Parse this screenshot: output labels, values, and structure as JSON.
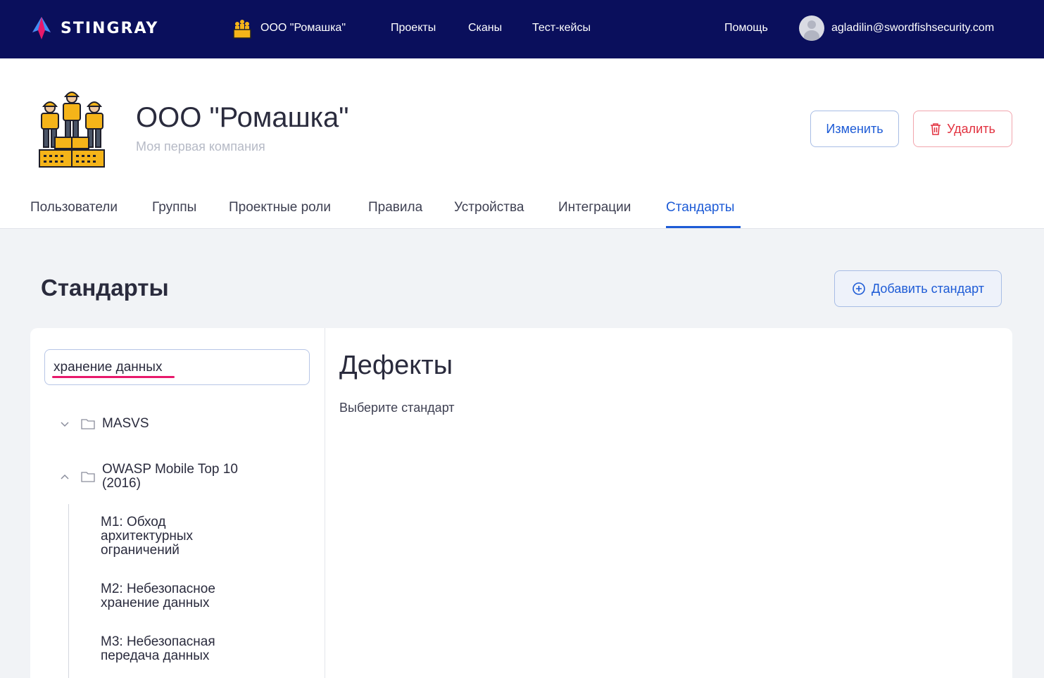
{
  "topbar": {
    "brand": "STINGRAY",
    "org_name": "ООО \"Ромашка\"",
    "nav": [
      "Проекты",
      "Сканы",
      "Тест-кейсы"
    ],
    "help": "Помощь",
    "user_email": "agladilin@swordfishsecurity.com",
    "background": "#0a0f5c"
  },
  "company": {
    "title": "ООО \"Ромашка\"",
    "subtitle": "Моя первая компания",
    "edit_label": "Изменить",
    "delete_label": "Удалить"
  },
  "tabs": [
    {
      "label": "Пользователи",
      "active": false
    },
    {
      "label": "Группы",
      "active": false
    },
    {
      "label": "Проектные роли",
      "active": false
    },
    {
      "label": "Правила",
      "active": false
    },
    {
      "label": "Устройства",
      "active": false
    },
    {
      "label": "Интеграции",
      "active": false
    },
    {
      "label": "Стандарты",
      "active": true
    }
  ],
  "section": {
    "title": "Стандарты",
    "add_label": "Добавить стандарт"
  },
  "search": {
    "value": "хранение данных"
  },
  "tree": {
    "nodes": [
      {
        "label": "MASVS",
        "expanded": false
      },
      {
        "label": "OWASP Mobile Top 10 (2016)",
        "expanded": true
      }
    ],
    "leaves": [
      "M1: Обход архитектурных ограничений",
      "M2: Небезопасное хранение данных",
      "M3: Небезопасная передача данных"
    ]
  },
  "detail": {
    "title": "Дефекты",
    "hint": "Выберите стандарт"
  },
  "colors": {
    "accent": "#1d5bd6",
    "danger": "#e2313f",
    "highlight": "#e8196b"
  }
}
